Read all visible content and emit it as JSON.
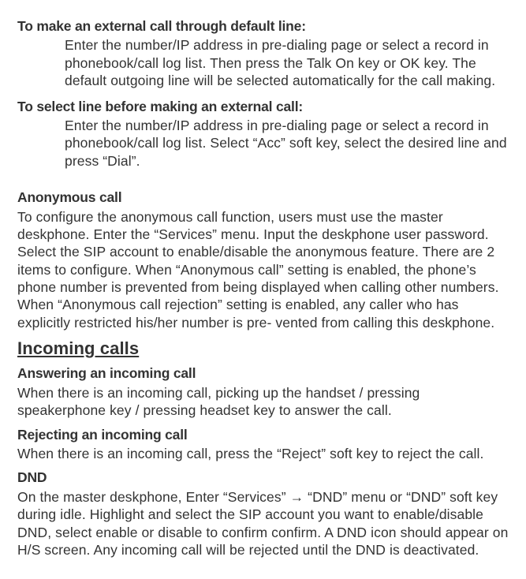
{
  "sec1": {
    "title": "To make an external call through default line:",
    "body": "Enter the number/IP address in pre-dialing page or select a record in phonebook/call log list. Then press the Talk On key or OK key. The default outgoing line will be selected automatically for the call making."
  },
  "sec2": {
    "title": "To select line before making an external call:",
    "body": "Enter the number/IP address in pre-dialing page or select a record in phonebook/call log list. Select “Acc” soft key, select the desired line and press “Dial”."
  },
  "anon": {
    "title": "Anonymous call",
    "body": "To configure the anonymous call function, users must use the master deskphone. Enter the “Services” menu. Input the deskphone user password. Select the SIP account to enable/disable the anonymous feature. There are 2 items to configure. When “Anonymous call” setting is enabled, the phone’s phone number is prevented from being displayed when calling other numbers. When “Anonymous call rejection” setting is enabled, any caller who has explicitly restricted his/her number is pre- vented from calling this deskphone."
  },
  "incoming_heading": "Incoming calls",
  "answer": {
    "title": "Answering an incoming call",
    "body": "When there is an incoming call, picking up the handset / pressing speakerphone key / pressing headset key to answer the call."
  },
  "reject": {
    "title": "Rejecting an incoming call",
    "body": "When there is an incoming call, press the “Reject” soft key to reject the call."
  },
  "dnd": {
    "title": "DND",
    "body_pre": "On the master deskphone, Enter “Services” ",
    "arrow": "→",
    "body_post": " “DND” menu or “DND” soft key during idle. Highlight and select the SIP account you want to enable/disable DND, select enable or disable to confirm confirm. A DND icon should appear on H/S screen. Any incoming call will be rejected until the DND is deactivated."
  }
}
